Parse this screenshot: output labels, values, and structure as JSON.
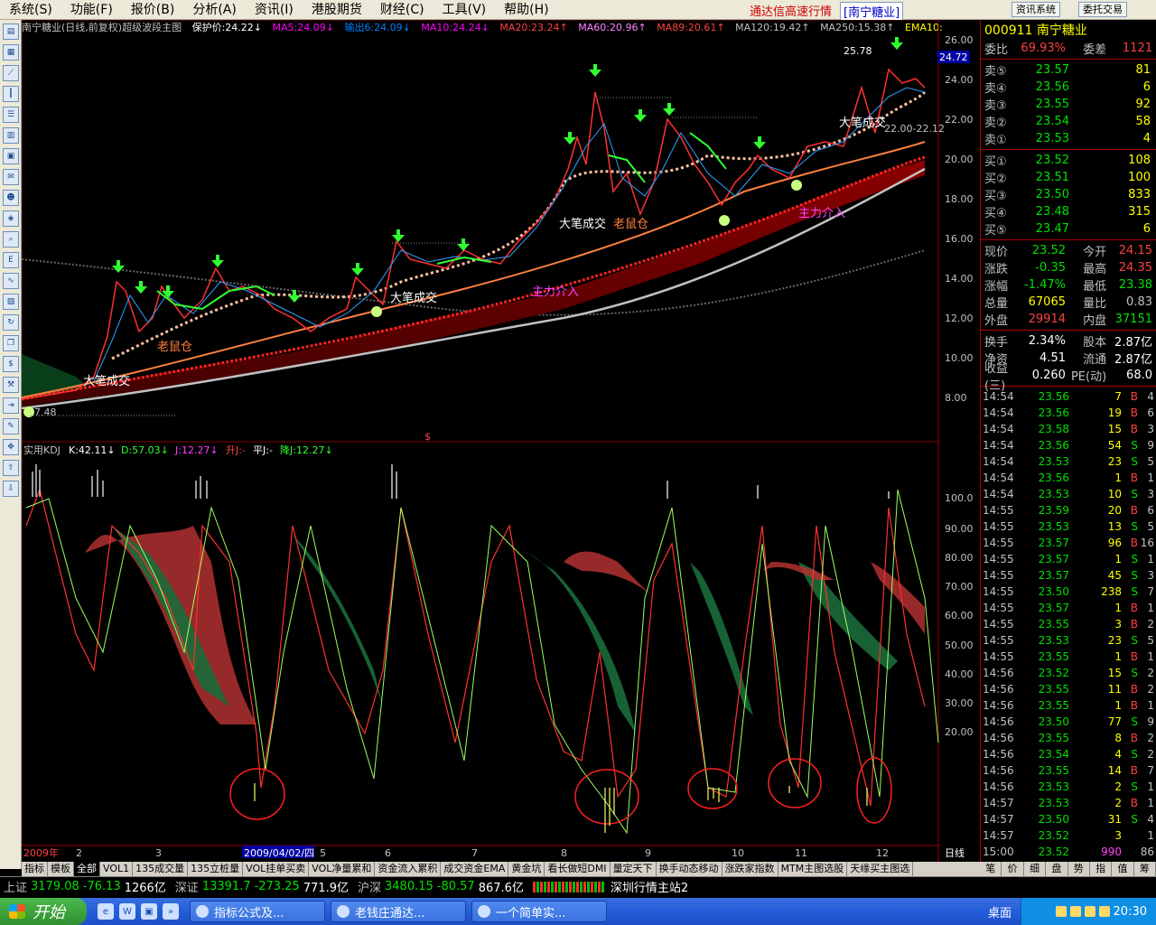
{
  "menu": [
    "系统(S)",
    "功能(F)",
    "报价(B)",
    "分析(A)",
    "资讯(I)",
    "港股期货",
    "财经(C)",
    "工具(V)",
    "帮助(H)"
  ],
  "menu_title": "通达信高速行情",
  "menu_stock": "[南宁糖业]",
  "menu_btn1": "资讯系统",
  "menu_btn2": "委托交易",
  "header": {
    "stock": "南宁糖业(日线,前复权)超级波段主图",
    "baohu": "保护价:24.22↓",
    "ma5": "MA5:24.09↓",
    "out": "输出6:24.09↓",
    "ma10": "MA10:24.24↓",
    "ma20": "MA20:23.24↑",
    "ma60": "MA60:20.96↑",
    "ma89": "MA89:20.61↑",
    "ma120": "MA120:19.42↑",
    "ma250": "MA250:15.38↑",
    "ema": "EMA10:"
  },
  "price_axis": [
    "26.00",
    "24.00",
    "22.00",
    "20.00",
    "18.00",
    "16.00",
    "14.00",
    "12.00",
    "10.00",
    "8.00"
  ],
  "kdj_axis": [
    "100.0",
    "90.00",
    "80.00",
    "70.00",
    "60.00",
    "50.00",
    "40.00",
    "30.00",
    "20.00"
  ],
  "kdj_header": {
    "name": "实用KDJ",
    "k": "K:42.11↓",
    "d": "D:57.03↓",
    "j": "J:12.27↓",
    "up": "升J:-",
    "flat": "平J:-",
    "down": "降J:12.27↓"
  },
  "annotations": {
    "high": "25.78",
    "low": "7.48",
    "big1": "大笔成交",
    "big2": "大笔成交",
    "big3": "大笔成交",
    "big4": "大笔成交",
    "rat1": "老鼠仓",
    "rat2": "老鼠仓",
    "main1": "主力介入",
    "main2": "主力介入",
    "range": "22.00-22.12",
    "cur_price": "24.72",
    "dollar": "$"
  },
  "date_axis": {
    "year": "2009年",
    "m2": "2",
    "m3": "3",
    "sel": "2009/04/02/四",
    "m5": "5",
    "m6": "6",
    "m7": "7",
    "m8": "8",
    "m9": "9",
    "m10": "10",
    "m11": "11",
    "m12": "12",
    "period": "日线"
  },
  "quote": {
    "code_name": "000911 南宁糖业",
    "weibi_label": "委比",
    "weibi": "69.93%",
    "weicha_label": "委差",
    "weicha": "1121",
    "sells": [
      {
        "l": "卖⑤",
        "p": "23.57",
        "v": "81"
      },
      {
        "l": "卖④",
        "p": "23.56",
        "v": "6"
      },
      {
        "l": "卖③",
        "p": "23.55",
        "v": "92"
      },
      {
        "l": "卖②",
        "p": "23.54",
        "v": "58"
      },
      {
        "l": "卖①",
        "p": "23.53",
        "v": "4"
      }
    ],
    "buys": [
      {
        "l": "买①",
        "p": "23.52",
        "v": "108"
      },
      {
        "l": "买②",
        "p": "23.51",
        "v": "100"
      },
      {
        "l": "买③",
        "p": "23.50",
        "v": "833"
      },
      {
        "l": "买④",
        "p": "23.48",
        "v": "315"
      },
      {
        "l": "买⑤",
        "p": "23.47",
        "v": "6"
      }
    ],
    "stats": [
      {
        "a": "现价",
        "b": "23.52",
        "c": "今开",
        "d": "24.15",
        "bc": "#00e000",
        "dc": "#ff4040"
      },
      {
        "a": "涨跌",
        "b": "-0.35",
        "c": "最高",
        "d": "24.35",
        "bc": "#00e000",
        "dc": "#ff4040"
      },
      {
        "a": "涨幅",
        "b": "-1.47%",
        "c": "最低",
        "d": "23.38",
        "bc": "#00e000",
        "dc": "#00e000"
      },
      {
        "a": "总量",
        "b": "67065",
        "c": "量比",
        "d": "0.83",
        "bc": "#ffff00",
        "dc": "#c0c0c0"
      },
      {
        "a": "外盘",
        "b": "29914",
        "c": "内盘",
        "d": "37151",
        "bc": "#ff4040",
        "dc": "#00e000"
      }
    ],
    "stats2": [
      {
        "a": "换手",
        "b": "2.34%",
        "c": "股本",
        "d": "2.87亿"
      },
      {
        "a": "净资",
        "b": "4.51",
        "c": "流通",
        "d": "2.87亿"
      },
      {
        "a": "收益(三)",
        "b": "0.260",
        "c": "PE(动)",
        "d": "68.0"
      }
    ],
    "ticks": [
      {
        "t": "14:54",
        "p": "23.56",
        "v": "7",
        "s": "B",
        "n": "4"
      },
      {
        "t": "14:54",
        "p": "23.56",
        "v": "19",
        "s": "B",
        "n": "6"
      },
      {
        "t": "14:54",
        "p": "23.58",
        "v": "15",
        "s": "B",
        "n": "3"
      },
      {
        "t": "14:54",
        "p": "23.56",
        "v": "54",
        "s": "S",
        "n": "9"
      },
      {
        "t": "14:54",
        "p": "23.53",
        "v": "23",
        "s": "S",
        "n": "5"
      },
      {
        "t": "14:54",
        "p": "23.56",
        "v": "1",
        "s": "B",
        "n": "1"
      },
      {
        "t": "14:54",
        "p": "23.53",
        "v": "10",
        "s": "S",
        "n": "3"
      },
      {
        "t": "14:55",
        "p": "23.59",
        "v": "20",
        "s": "B",
        "n": "6"
      },
      {
        "t": "14:55",
        "p": "23.53",
        "v": "13",
        "s": "S",
        "n": "5"
      },
      {
        "t": "14:55",
        "p": "23.57",
        "v": "96",
        "s": "B",
        "n": "16"
      },
      {
        "t": "14:55",
        "p": "23.57",
        "v": "1",
        "s": "S",
        "n": "1"
      },
      {
        "t": "14:55",
        "p": "23.57",
        "v": "45",
        "s": "S",
        "n": "3"
      },
      {
        "t": "14:55",
        "p": "23.50",
        "v": "238",
        "s": "S",
        "n": "7"
      },
      {
        "t": "14:55",
        "p": "23.57",
        "v": "1",
        "s": "B",
        "n": "1"
      },
      {
        "t": "14:55",
        "p": "23.55",
        "v": "3",
        "s": "B",
        "n": "2"
      },
      {
        "t": "14:55",
        "p": "23.53",
        "v": "23",
        "s": "S",
        "n": "5"
      },
      {
        "t": "14:55",
        "p": "23.55",
        "v": "1",
        "s": "B",
        "n": "1"
      },
      {
        "t": "14:56",
        "p": "23.52",
        "v": "15",
        "s": "S",
        "n": "2"
      },
      {
        "t": "14:56",
        "p": "23.55",
        "v": "11",
        "s": "B",
        "n": "2"
      },
      {
        "t": "14:56",
        "p": "23.55",
        "v": "1",
        "s": "B",
        "n": "1"
      },
      {
        "t": "14:56",
        "p": "23.50",
        "v": "77",
        "s": "S",
        "n": "9"
      },
      {
        "t": "14:56",
        "p": "23.55",
        "v": "8",
        "s": "B",
        "n": "2"
      },
      {
        "t": "14:56",
        "p": "23.54",
        "v": "4",
        "s": "S",
        "n": "2"
      },
      {
        "t": "14:56",
        "p": "23.55",
        "v": "14",
        "s": "B",
        "n": "7"
      },
      {
        "t": "14:56",
        "p": "23.53",
        "v": "2",
        "s": "S",
        "n": "1"
      },
      {
        "t": "14:57",
        "p": "23.53",
        "v": "2",
        "s": "B",
        "n": "1"
      },
      {
        "t": "14:57",
        "p": "23.50",
        "v": "31",
        "s": "S",
        "n": "4"
      },
      {
        "t": "14:57",
        "p": "23.52",
        "v": "3",
        "s": "",
        "n": "1"
      },
      {
        "t": "15:00",
        "p": "23.52",
        "v": "990",
        "s": "",
        "n": "86"
      }
    ]
  },
  "tabs": [
    "指标",
    "模板",
    "全部",
    "VOL1",
    "135成交量",
    "135立桩量",
    "VOL挂单买卖",
    "VOL净量累和",
    "资金流入累积",
    "成交资金EMA",
    "黄金坑",
    "看长做短DMI",
    "量定天下",
    "换手动态移动",
    "涨跌家指数",
    "MTM主图选股",
    "天缘买主图选"
  ],
  "rtabs": [
    "笔",
    "价",
    "细",
    "盘",
    "势",
    "指",
    "值",
    "筹"
  ],
  "index": {
    "sh_label": "上证",
    "sh": "3179.08",
    "sh_chg": "-76.13",
    "sh_amt": "1266亿",
    "sz_label": "深证",
    "sz": "13391.7",
    "sz_chg": "-273.25",
    "sz_amt": "771.9亿",
    "hs_label": "沪深",
    "hs": "3480.15",
    "hs_chg": "-80.57",
    "hs_amt": "867.6亿",
    "station": "深圳行情主站2"
  },
  "taskbar": {
    "start": "开始",
    "t1": "指标公式及...",
    "t2": "老钱庄通达...",
    "t3": "一个简单实...",
    "desk": "桌面",
    "clock": "20:30"
  }
}
